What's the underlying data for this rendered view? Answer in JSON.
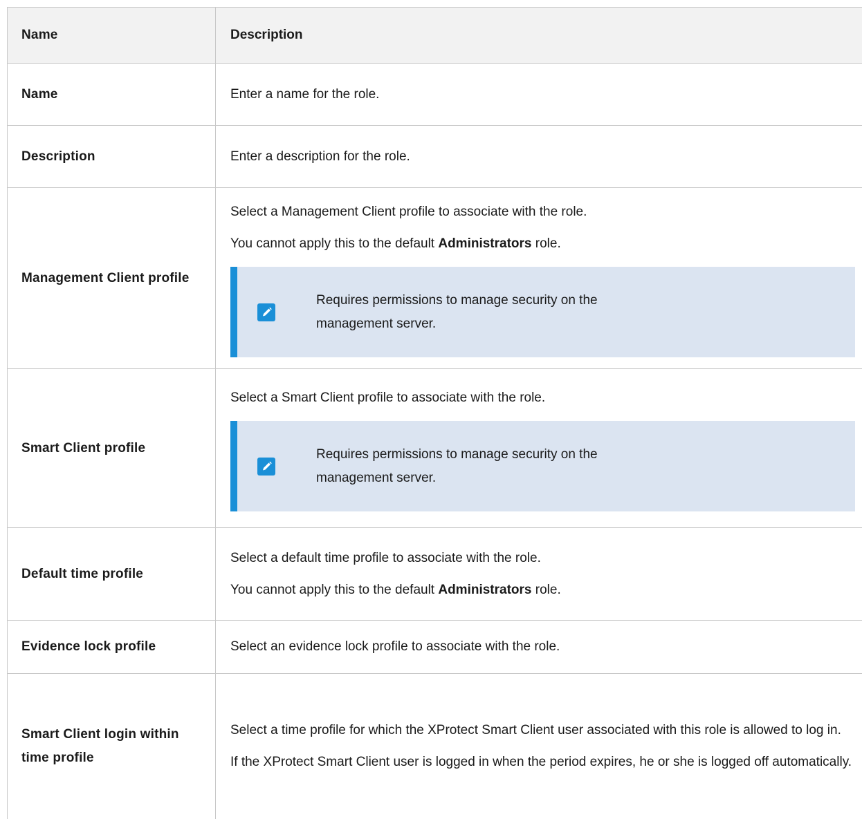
{
  "header": {
    "name": "Name",
    "description": "Description"
  },
  "rows": [
    {
      "name": "Name",
      "paragraphs": [
        {
          "text": "Enter a name for the role."
        }
      ]
    },
    {
      "name": "Description",
      "paragraphs": [
        {
          "text": "Enter a description for the role."
        }
      ]
    },
    {
      "name": "Management Client profile",
      "paragraphs": [
        {
          "text": "Select a Management Client profile to associate with the role."
        },
        {
          "pre": "You cannot apply this to the default ",
          "bold": "Administrators",
          "post": " role."
        }
      ],
      "note": {
        "icon": "pencil-icon",
        "line1": "Requires permissions to manage security on the",
        "line2": "management server."
      }
    },
    {
      "name": "Smart Client profile",
      "paragraphs": [
        {
          "text": "Select a Smart Client profile to associate with the role."
        }
      ],
      "note": {
        "icon": "pencil-icon",
        "line1": "Requires permissions to manage security on the",
        "line2": "management server."
      }
    },
    {
      "name": "Default time profile",
      "paragraphs": [
        {
          "text": "Select a default time profile to associate with the role."
        },
        {
          "pre": "You cannot apply this to the default ",
          "bold": "Administrators",
          "post": " role."
        }
      ]
    },
    {
      "name": "Evidence lock profile",
      "paragraphs": [
        {
          "text": "Select an evidence lock profile to associate with the role."
        }
      ]
    },
    {
      "name": "Smart Client login within time profile",
      "paragraphs": [
        {
          "text": "Select a time profile for which the XProtect Smart Client user associated with this role is allowed to log in."
        },
        {
          "text": "If the XProtect Smart Client user is logged in when the period expires, he or she is logged off automatically."
        }
      ]
    }
  ],
  "colors": {
    "note_bg": "#dbe4f1",
    "note_accent": "#1a8fd7",
    "header_bg": "#f2f2f2",
    "border": "#c8c8c8"
  }
}
